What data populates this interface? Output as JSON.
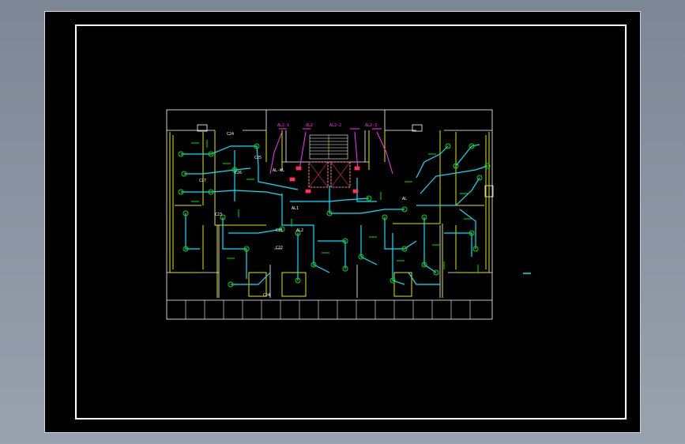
{
  "colors": {
    "wall": "#ffffff",
    "partition": "#e6e600",
    "circuit": "#00e5ff",
    "device": "#00e000",
    "panel": "#ff3355",
    "tag": "#ff33ff",
    "background": "#000000"
  },
  "drawing": {
    "tags": {
      "al2_1": "AL2-1",
      "al2_main": "AL2",
      "al2_2": "AL2-2",
      "al2_3": "AL2-3"
    },
    "labels": {
      "c24_top": "C24",
      "c24_bottom": "C24",
      "c25": "C25",
      "c26": "C26",
      "c27": "C27",
      "c21": "C21",
      "c22": "C22",
      "c23": "C23",
      "al_wl": "AL-WL",
      "al": "AL",
      "al1": "AL1",
      "al2": "AL2"
    }
  }
}
